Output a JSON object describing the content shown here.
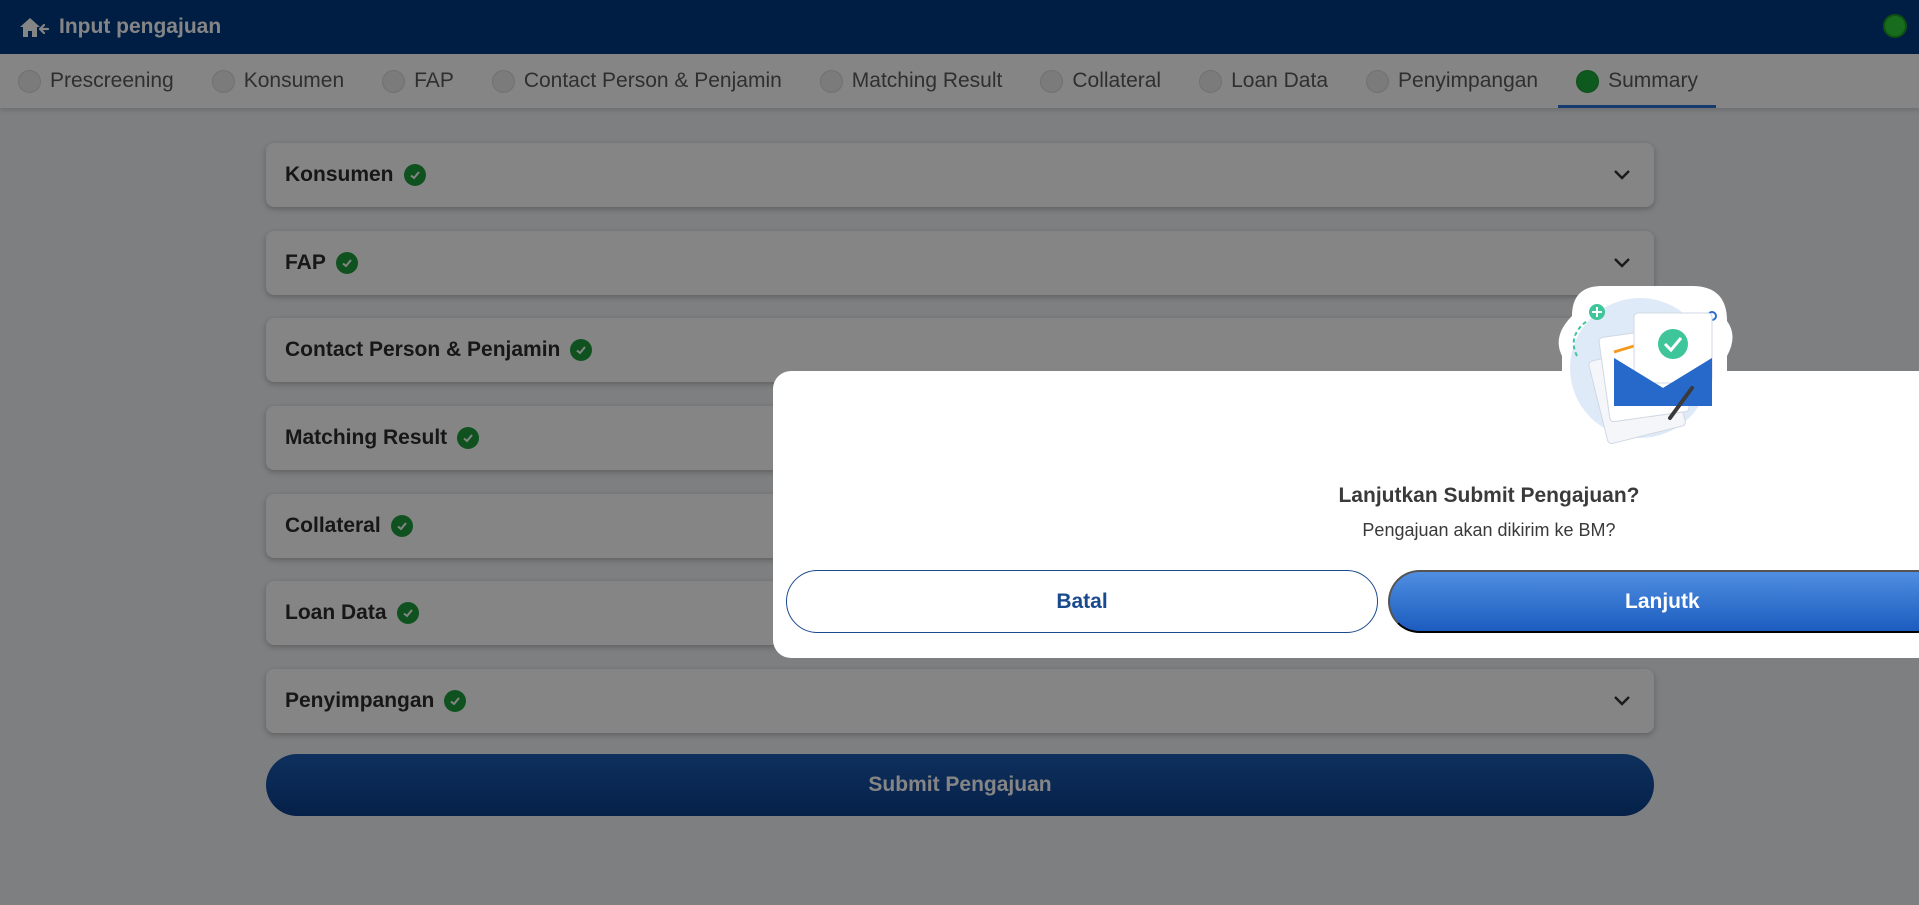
{
  "header": {
    "title": "Input pengajuan",
    "home_icon": "home-back-icon",
    "status_icon": "online-status-icon",
    "status_color": "#2fd03a"
  },
  "tabs": [
    {
      "label": "Prescreening",
      "active": false
    },
    {
      "label": "Konsumen",
      "active": false
    },
    {
      "label": "FAP",
      "active": false
    },
    {
      "label": "Contact Person & Penjamin",
      "active": false
    },
    {
      "label": "Matching Result",
      "active": false
    },
    {
      "label": "Collateral",
      "active": false
    },
    {
      "label": "Loan Data",
      "active": false
    },
    {
      "label": "Penyimpangan",
      "active": false
    },
    {
      "label": "Summary",
      "active": true
    }
  ],
  "sections": [
    {
      "label": "Konsumen"
    },
    {
      "label": "FAP"
    },
    {
      "label": "Contact Person & Penjamin"
    },
    {
      "label": "Matching Result"
    },
    {
      "label": "Collateral"
    },
    {
      "label": "Loan Data"
    },
    {
      "label": "Penyimpangan"
    }
  ],
  "submit_label": "Submit Pengajuan",
  "dialog": {
    "heading": "Lanjutkan Submit Pengajuan?",
    "message": "Pengajuan akan dikirim ke BM?",
    "cancel_label": "Batal",
    "continue_label": "Lanjutk",
    "illustration": "envelope-check-icon"
  },
  "colors": {
    "primary": "#003a82",
    "accent": "#2a6fd1",
    "success": "#1e9e3e"
  }
}
